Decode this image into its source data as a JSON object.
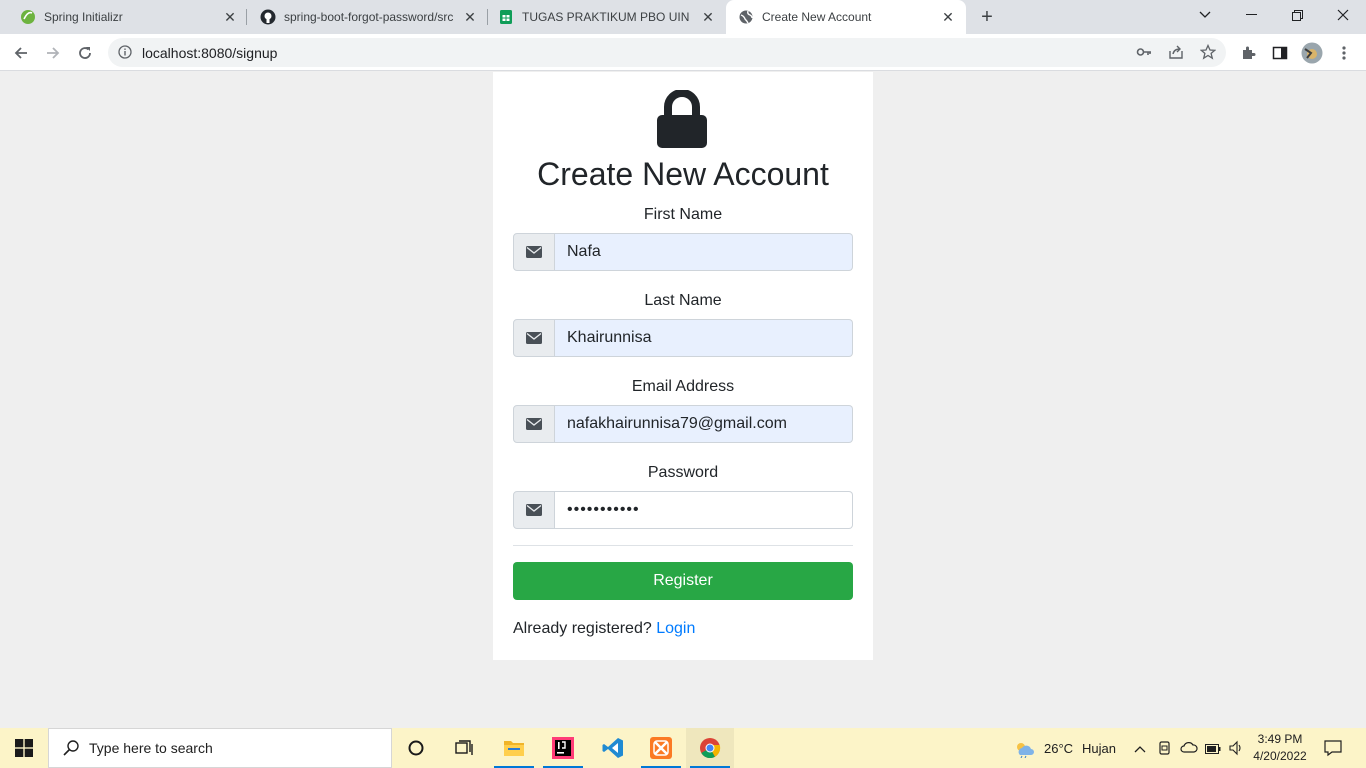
{
  "browser": {
    "tabs": [
      {
        "title": "Spring Initializr",
        "favicon": "spring-icon"
      },
      {
        "title": "spring-boot-forgot-password/src",
        "favicon": "github-icon"
      },
      {
        "title": "TUGAS PRAKTIKUM PBO UIN SGD",
        "favicon": "sheets-icon"
      },
      {
        "title": "Create New Account",
        "favicon": "globe-icon",
        "active": true
      }
    ],
    "url": "localhost:8080/signup"
  },
  "form": {
    "title": "Create New Account",
    "fields": [
      {
        "label": "First Name",
        "value": "Nafa",
        "icon": "envelope-icon"
      },
      {
        "label": "Last Name",
        "value": "Khairunnisa",
        "icon": "envelope-icon"
      },
      {
        "label": "Email Address",
        "value": "nafakhairunnisa79@gmail.com",
        "icon": "envelope-icon"
      },
      {
        "label": "Password",
        "value": "•••••••••••",
        "icon": "envelope-icon"
      }
    ],
    "register_label": "Register",
    "already_text": "Already registered?",
    "login_link": "Login",
    "colors": {
      "register": "#28a745",
      "link": "#007bff",
      "autofill": "#e8f0fe"
    }
  },
  "taskbar": {
    "search_placeholder": "Type here to search",
    "weather_temp": "26°C",
    "weather_desc": "Hujan",
    "time": "3:49 PM",
    "date": "4/20/2022"
  }
}
